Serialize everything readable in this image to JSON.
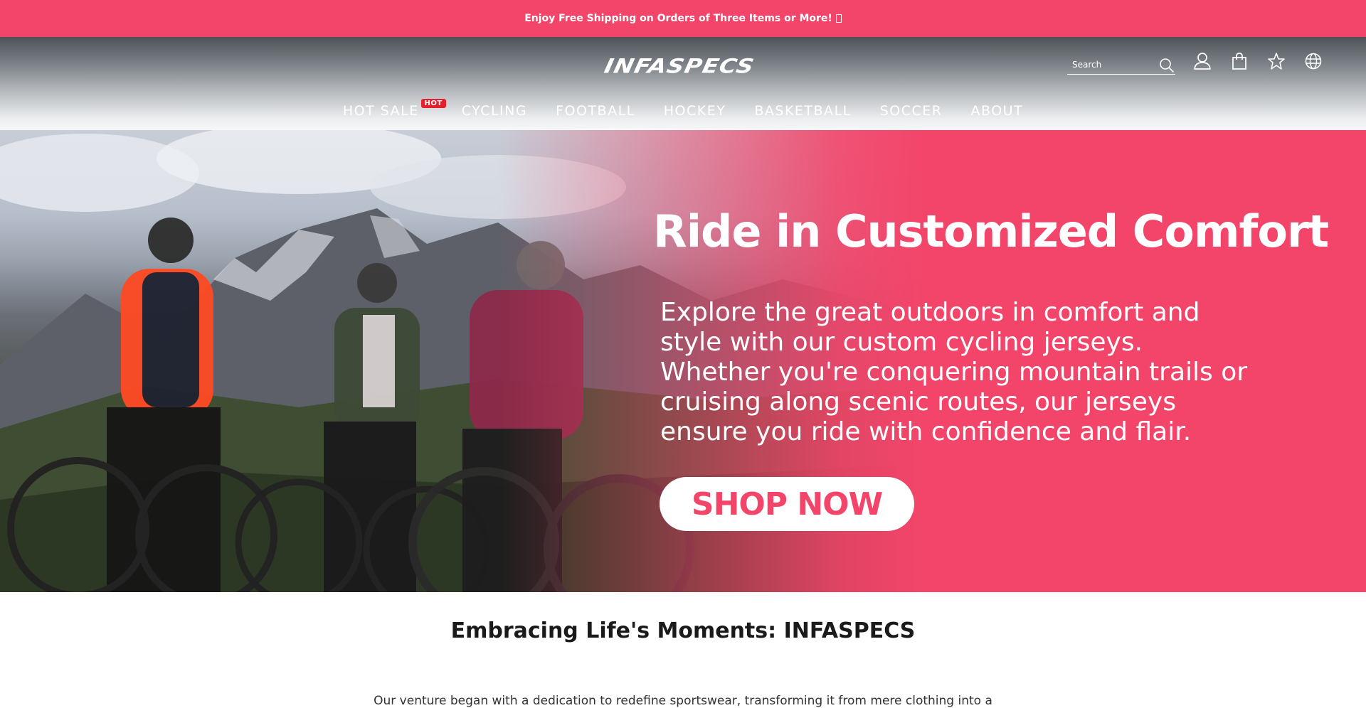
{
  "announcement": {
    "text": "Enjoy Free Shipping on Orders of Three Items or More!"
  },
  "header": {
    "logo_text": "INFASPECS",
    "search": {
      "placeholder": "Search"
    },
    "icons": [
      "search-icon",
      "user-icon",
      "shopping-bag-icon",
      "star-icon",
      "globe-icon"
    ]
  },
  "nav": {
    "items": [
      {
        "label": "HOT SALE",
        "badge": "HOT"
      },
      {
        "label": "CYCLING"
      },
      {
        "label": "FOOTBALL"
      },
      {
        "label": "HOCKEY"
      },
      {
        "label": "BASKETBALL"
      },
      {
        "label": "SOCCER"
      },
      {
        "label": "ABOUT"
      }
    ]
  },
  "hero": {
    "title": "Ride in Customized Comfort",
    "body": "Explore the great outdoors in comfort and style with our custom cycling jerseys. Whether you're conquering mountain trails or cruising along scenic routes, our jerseys ensure you ride with confidence and flair.",
    "cta_label": "SHOP NOW"
  },
  "section": {
    "title": "Embracing Life's Moments: INFASPECS",
    "body": "Our venture began with a dedication to redefine sportswear, transforming it from mere clothing into a"
  },
  "colors": {
    "brand_pink": "#f3456a",
    "hot_badge": "#e61f2a",
    "header_dark": "#4e5358"
  }
}
